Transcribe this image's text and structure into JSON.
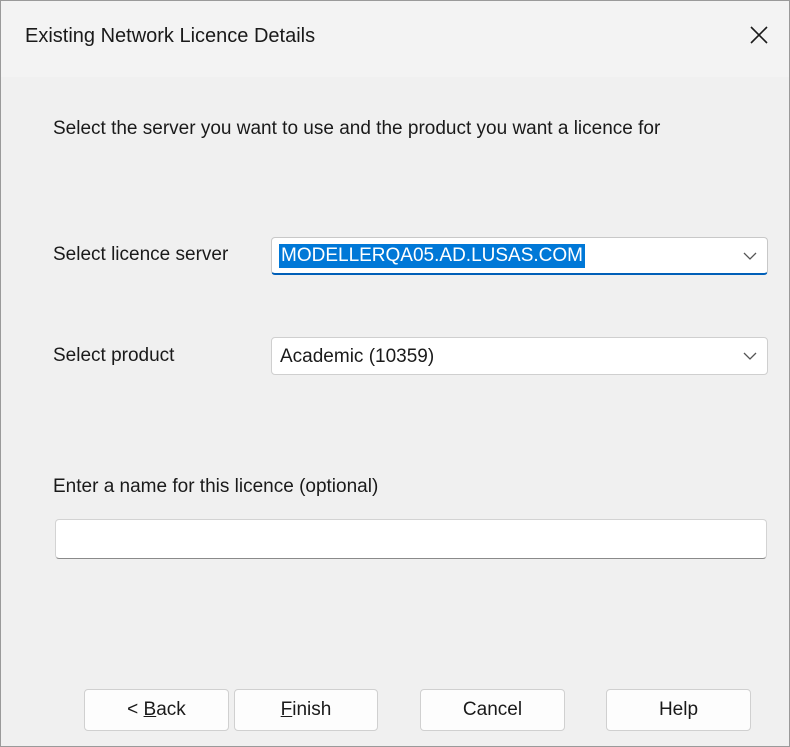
{
  "window": {
    "title": "Existing Network Licence Details",
    "close_glyph": "close-icon"
  },
  "instruction": "Select the server you want to use and the product you want a licence for",
  "server": {
    "label": "Select licence server",
    "value": "MODELLERQA05.AD.LUSAS.COM"
  },
  "product": {
    "label": "Select product",
    "value": "Academic (10359)"
  },
  "licence_name": {
    "label": "Enter a name for this licence (optional)",
    "value": "",
    "placeholder": ""
  },
  "buttons": {
    "back": {
      "prefix": "< ",
      "mnemonic": "B",
      "rest": "ack"
    },
    "finish": {
      "mnemonic": "F",
      "rest": "inish"
    },
    "cancel": "Cancel",
    "help": "Help"
  },
  "colors": {
    "selection": "#0078d7",
    "focus_underline": "#005fb8"
  }
}
